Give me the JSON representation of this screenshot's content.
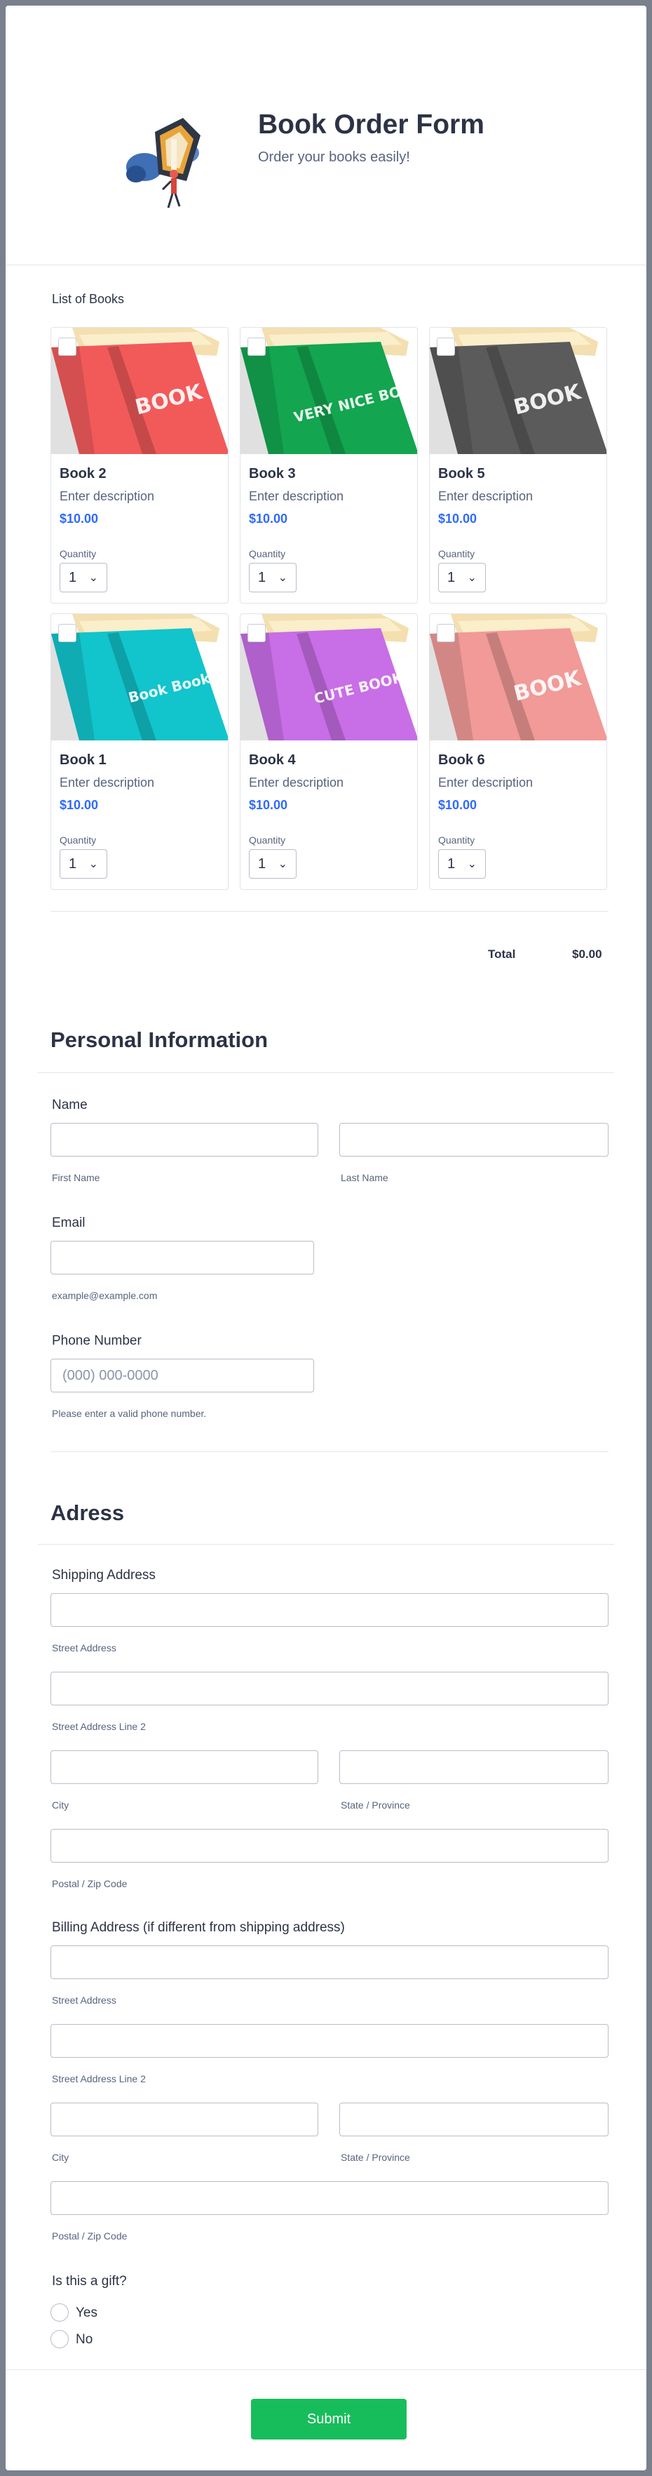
{
  "header": {
    "title": "Book Order Form",
    "subtitle": "Order your books easily!"
  },
  "products": {
    "label": "List of Books",
    "items": [
      {
        "name": "Book 2",
        "description": "Enter description",
        "price": "$10.00",
        "quantity_label": "Quantity",
        "quantity": "1",
        "cover_color": "#f25a5a",
        "cover_text": "BOOK"
      },
      {
        "name": "Book 3",
        "description": "Enter description",
        "price": "$10.00",
        "quantity_label": "Quantity",
        "quantity": "1",
        "cover_color": "#13a54f",
        "cover_text": "VERY NICE BOOK"
      },
      {
        "name": "Book 5",
        "description": "Enter description",
        "price": "$10.00",
        "quantity_label": "Quantity",
        "quantity": "1",
        "cover_color": "#5b5b5b",
        "cover_text": "BOOK"
      },
      {
        "name": "Book 1",
        "description": "Enter description",
        "price": "$10.00",
        "quantity_label": "Quantity",
        "quantity": "1",
        "cover_color": "#12c4cc",
        "cover_text": "Book Book"
      },
      {
        "name": "Book 4",
        "description": "Enter description",
        "price": "$10.00",
        "quantity_label": "Quantity",
        "quantity": "1",
        "cover_color": "#c86ee6",
        "cover_text": "CUTE BOOK"
      },
      {
        "name": "Book 6",
        "description": "Enter description",
        "price": "$10.00",
        "quantity_label": "Quantity",
        "quantity": "1",
        "cover_color": "#f19a98",
        "cover_text": "BOOK"
      }
    ],
    "total_label": "Total",
    "total_value": "$0.00"
  },
  "personal": {
    "heading": "Personal Information",
    "name_label": "Name",
    "first_name_sub": "First Name",
    "last_name_sub": "Last Name",
    "email_label": "Email",
    "email_sub": "example@example.com",
    "phone_label": "Phone Number",
    "phone_placeholder": "(000) 000-0000",
    "phone_sub": "Please enter a valid phone number."
  },
  "address": {
    "heading": "Adress",
    "shipping_label": "Shipping Address",
    "billing_label": "Billing Address (if different from shipping address)",
    "street_sub": "Street Address",
    "street2_sub": "Street Address Line 2",
    "city_sub": "City",
    "state_sub": "State / Province",
    "postal_sub": "Postal / Zip Code"
  },
  "gift": {
    "label": "Is this a gift?",
    "options": [
      "Yes",
      "No"
    ]
  },
  "submit_label": "Submit",
  "colors": {
    "accent_price": "#2e69ff",
    "submit": "#18bd5b",
    "page_background": "#7a808c"
  }
}
